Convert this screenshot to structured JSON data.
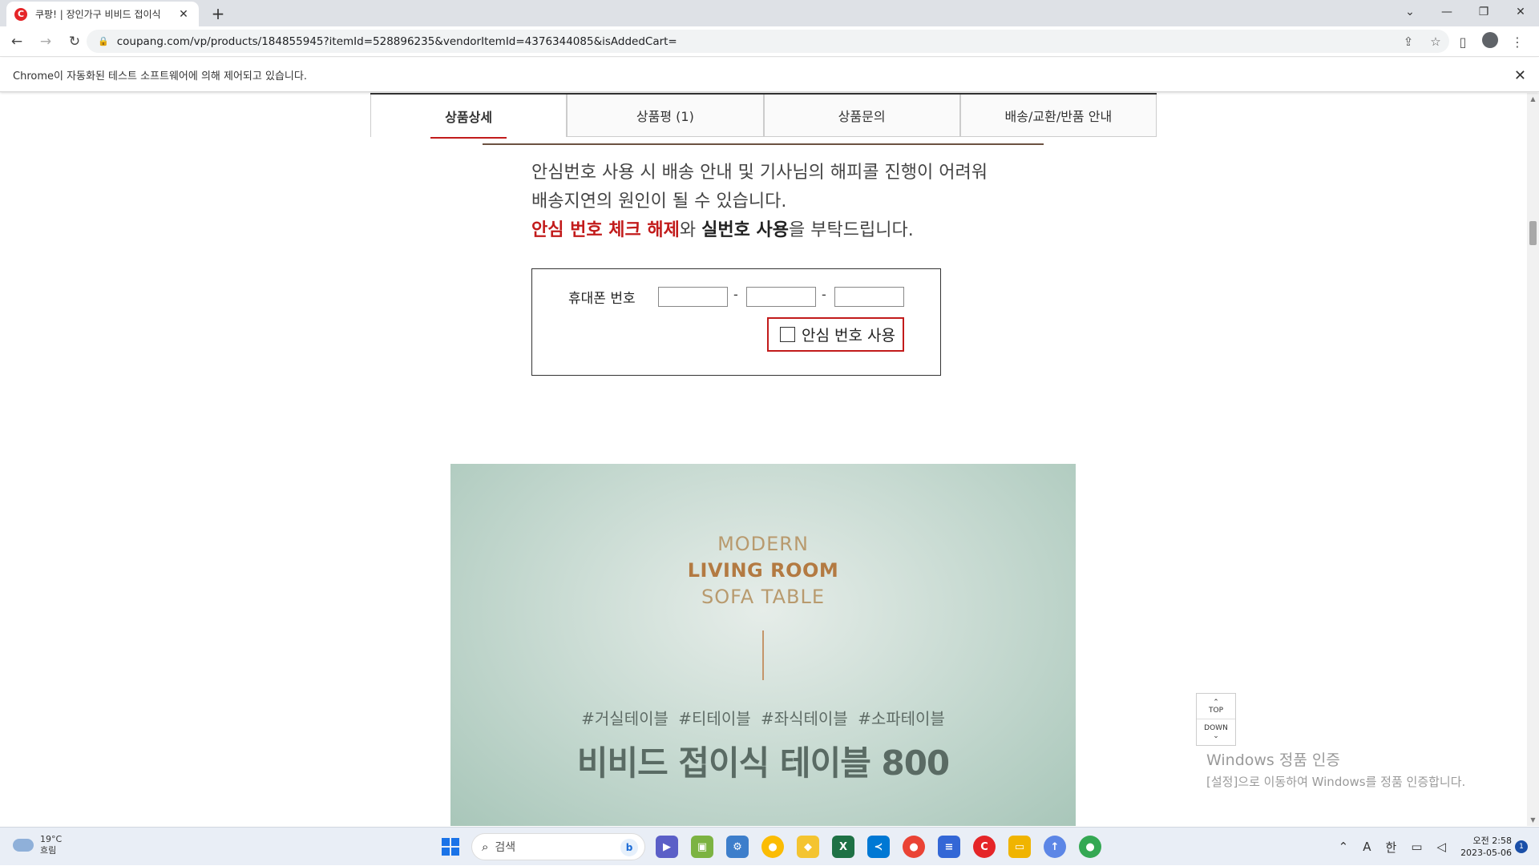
{
  "browser": {
    "tab_title": "쿠팡! | 장인가구 비비드 접이식",
    "favicon_letter": "C",
    "url": "coupang.com/vp/products/184855945?itemId=528896235&vendorItemId=4376344085&isAddedCart="
  },
  "infobar": {
    "message": "Chrome이 자동화된 테스트 소프트웨어에 의해 제어되고 있습니다."
  },
  "product_tabs": [
    {
      "label": "상품상세"
    },
    {
      "label": "상품평 (1)"
    },
    {
      "label": "상품문의"
    },
    {
      "label": "배송/교환/반품 안내"
    }
  ],
  "notice": {
    "line1": "안심번호 사용 시 배송 안내 및 기사님의 해피콜 진행이 어려워",
    "line2": "배송지연의 원인이 될 수 있습니다.",
    "line3_red": "안심 번호 체크 해제",
    "line3_mid": "와 ",
    "line3_bold": "실번호 사용",
    "line3_end": "을 부탁드립니다."
  },
  "phone_form": {
    "label": "휴대폰 번호",
    "separator": "-",
    "checkbox_label": "안심 번호 사용"
  },
  "banner": {
    "line1": "MODERN",
    "line2": "LIVING ROOM",
    "line3": "SOFA TABLE",
    "tags": "#거실테이블  #티테이블  #좌식테이블  #소파테이블",
    "title": "비비드 접이식 테이블 800"
  },
  "scroll_widget": {
    "top": "TOP",
    "down": "DOWN"
  },
  "watermark": {
    "line1": "Windows 정품 인증",
    "line2": "[설정]으로 이동하여 Windows를 정품 인증합니다."
  },
  "taskbar": {
    "temperature": "19°C",
    "weather": "흐림",
    "search_placeholder": "검색",
    "ime_a": "A",
    "ime_lang": "한",
    "time": "오전 2:58",
    "date": "2023-05-06",
    "notification_count": "1"
  },
  "colors": {
    "accent_red": "#c21b1b",
    "banner_green": "#c4d8cf",
    "banner_brown": "#b37a42"
  }
}
